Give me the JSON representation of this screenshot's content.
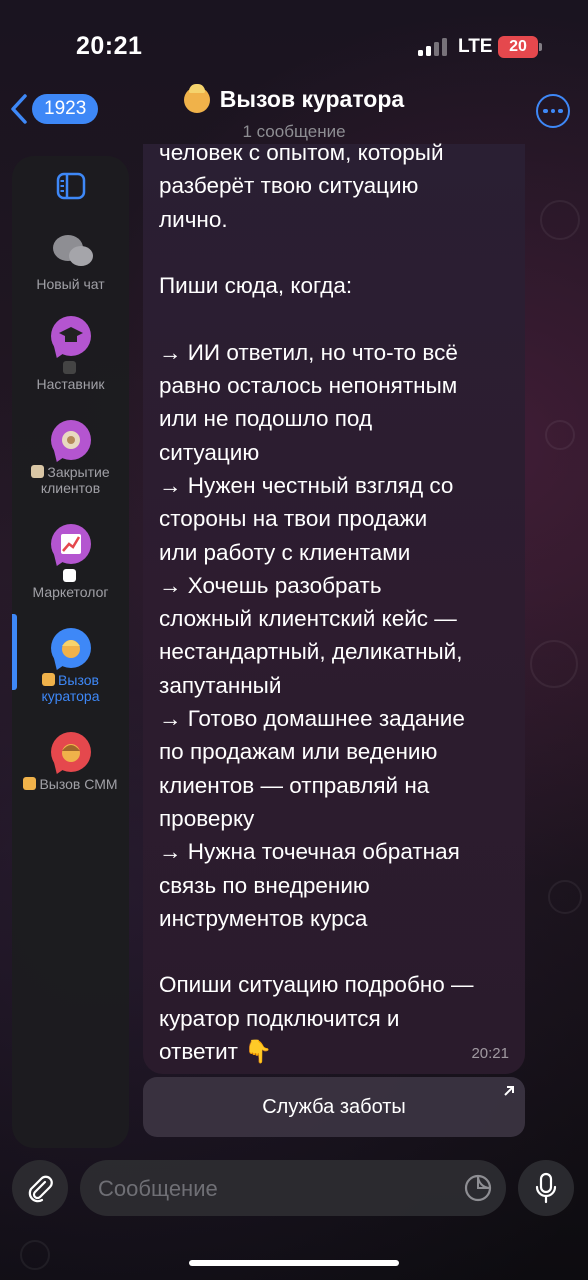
{
  "status_bar": {
    "time": "20:21",
    "network": "LTE",
    "battery": "20"
  },
  "header": {
    "back_count": "1923",
    "title": "Вызов куратора",
    "subtitle": "1 сообщение",
    "title_icon": "curator-emoji-icon"
  },
  "sidebar": {
    "items": [
      {
        "label": "Новый чат",
        "icon": "chat-bubbles-icon",
        "color": "#8e8e93"
      },
      {
        "label": "Наставник",
        "icon": "graduation-cap-icon",
        "color": "#b455d0"
      },
      {
        "label": "Закрытие клиентов",
        "icon": "handshake-icon",
        "color": "#b455d0"
      },
      {
        "label": "Маркетолог",
        "icon": "chart-up-icon",
        "color": "#b455d0"
      },
      {
        "label": "Вызов куратора",
        "icon": "curator-icon",
        "color": "#3e88f7",
        "active": true
      },
      {
        "label": "Вызов СММ",
        "icon": "smm-icon",
        "color": "#e5484d"
      }
    ]
  },
  "message": {
    "text": "человек с опытом, который\nразберёт твою ситуацию\nлично.\n\nПиши сюда, когда:\n\n→ ИИ ответил, но что-то всё\nравно осталось непонятным\nили не подошло под\nситуацию\n→ Нужен честный взгляд со\nстороны на твои продажи\nили работу с клиентами\n→ Хочешь разобрать\nсложный клиентский кейс —\nнестандартный, деликатный,\nзапутанный\n→ Готово домашнее задание\nпо продажам или ведению\nклиентов — отправляй на\nпроверку\n→ Нужна точечная обратная\nсвязь по внедрению\nинструментов курса\n\nОпиши ситуацию подробно —\nкуратор подключится и\nответит 👇",
    "time": "20:21"
  },
  "inline_button": {
    "label": "Служба заботы"
  },
  "composer": {
    "placeholder": "Сообщение"
  },
  "colors": {
    "accent": "#3e88f7",
    "battery": "#e5484d"
  }
}
